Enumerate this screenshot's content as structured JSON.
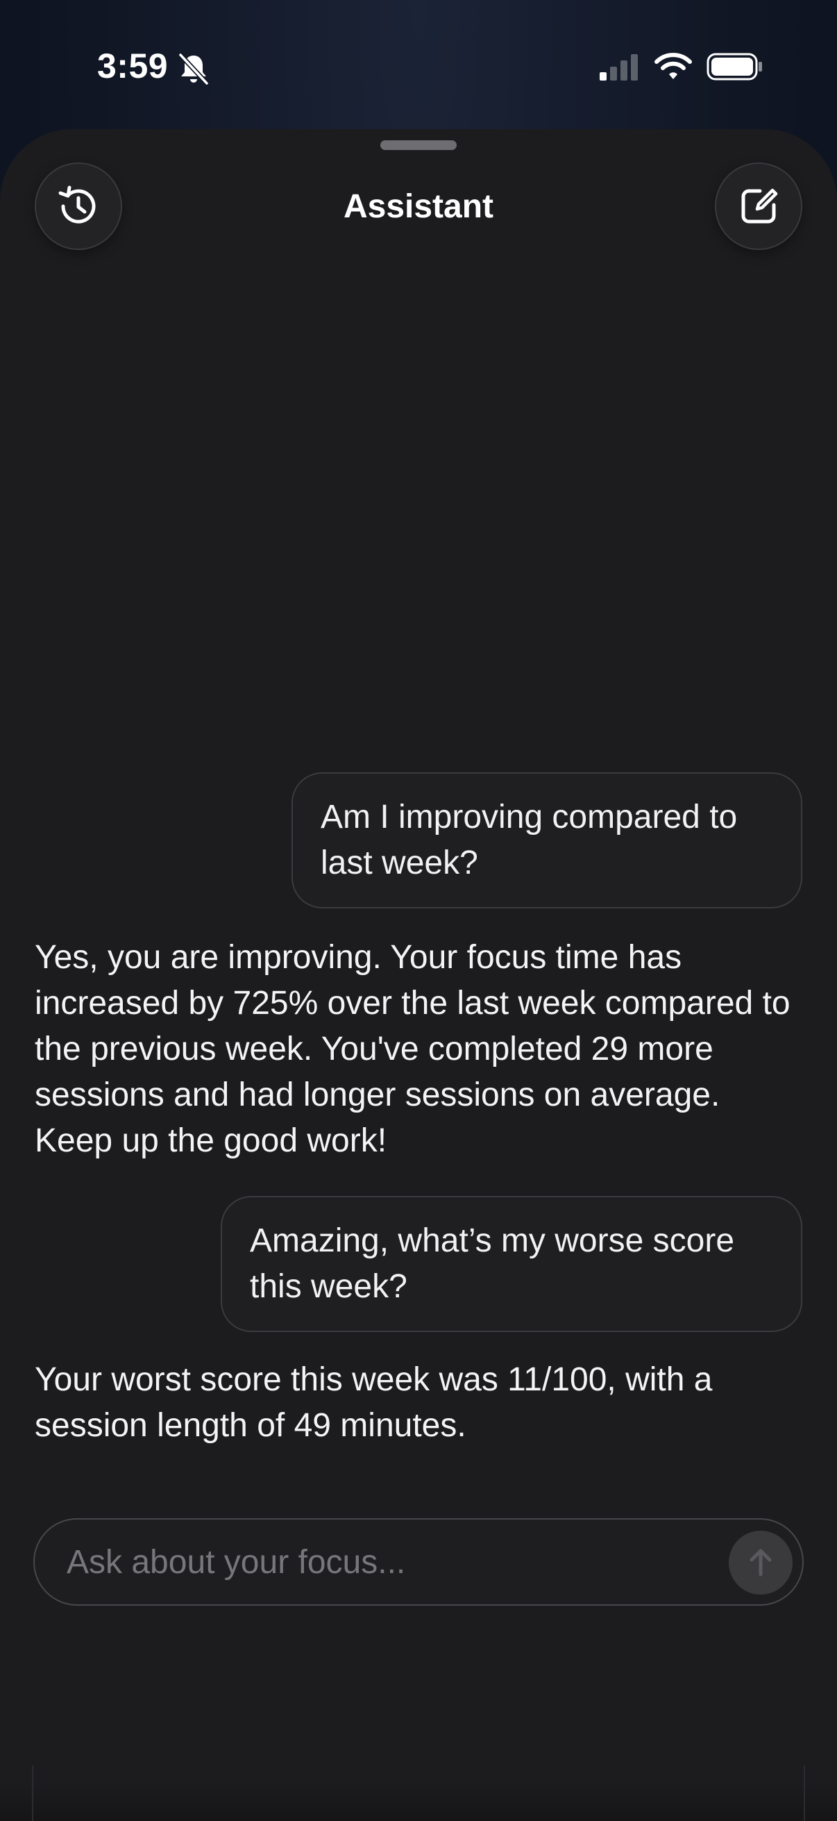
{
  "status_bar": {
    "time": "3:59",
    "icons": [
      "bell-slash-icon",
      "cellular-signal-icon",
      "wifi-icon",
      "battery-icon"
    ]
  },
  "header": {
    "title": "Assistant",
    "left_button_icon": "history-clock-icon",
    "right_button_icon": "compose-icon"
  },
  "messages": [
    {
      "role": "user",
      "text": "Am I improving compared to last week?"
    },
    {
      "role": "assistant",
      "text": "Yes, you are improving. Your focus time has increased by 725% over the last week compared to the previous week. You've completed 29 more sessions and had longer sessions on average. Keep up the good work!"
    },
    {
      "role": "user",
      "text": "Amazing, what’s my worse score this week?"
    },
    {
      "role": "assistant",
      "text": "Your worst score this week was 11/100, with a session length of 49 minutes."
    }
  ],
  "input": {
    "placeholder": "Ask about your focus...",
    "value": "",
    "send_icon": "arrow-up-icon"
  },
  "colors": {
    "sheet_background": "#1c1c1e",
    "page_background": "#101624",
    "bubble_border": "#3b3b3f",
    "placeholder": "#77777b",
    "send_button": "#3a3a3d"
  }
}
